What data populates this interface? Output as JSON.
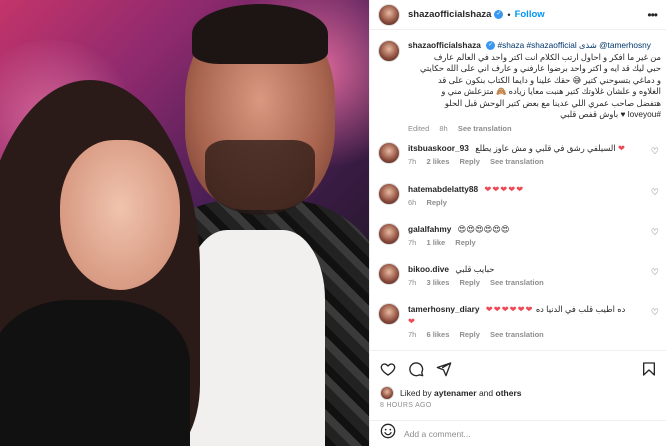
{
  "header": {
    "username": "shazaofficialshaza",
    "separator": "•",
    "follow_label": "Follow",
    "more_icon": "more-horizontal-icon"
  },
  "caption": {
    "username": "shazaofficialshaza",
    "tags_line": "#shaza #shazaofficial شذى @tamerhosny",
    "text_lines": [
      "من غير ما افكر و احاول ارتب الكلام انت اكتر واحد في العالم عارف",
      "حبي ليك قد ايه و اكتر واحد برضوا عارفني و عارف اني على الله حكايتي",
      "و دماغي بتسوحني كتير 😅 حقك علينا و دايما الكتاب بنكون على قد",
      "الغلاوه و علشان غلاوتك كتير هنبت معايا زياده 🙈 متزعلش مني و",
      "هتفضل صاحب عمري اللي عدينا مع بعض كتير الوحش قبل الحلو",
      "#loveyou ♥ باوش قفص قلبي"
    ],
    "edited": "Edited",
    "time": "8h",
    "see_translation": "See translation"
  },
  "comments": [
    {
      "username": "itsbuaskoor_93",
      "text": "السيلفي رشق في قلبي و مش عاوز يطلع",
      "hearts": "❤",
      "time": "7h",
      "likes": "2 likes",
      "reply": "Reply",
      "see_translation": "See translation"
    },
    {
      "username": "hatemabdelatty88",
      "text": "",
      "hearts": "❤❤❤❤❤",
      "time": "6h",
      "likes": "",
      "reply": "Reply",
      "see_translation": ""
    },
    {
      "username": "galalfahmy",
      "text": "",
      "hearts": "😍😍😍😍😍😍",
      "time": "7h",
      "likes": "1 like",
      "reply": "Reply",
      "see_translation": ""
    },
    {
      "username": "bikoo.dive",
      "text": "حبايب قلبي",
      "hearts": "",
      "time": "7h",
      "likes": "3 likes",
      "reply": "Reply",
      "see_translation": "See translation"
    },
    {
      "username": "tamerhosny_diary",
      "text": "ده اطيب قلب في الدنيا ده",
      "hearts": "❤❤❤❤❤❤",
      "hearts2": "❤",
      "time": "7h",
      "likes": "6 likes",
      "reply": "Reply",
      "see_translation": "See translation"
    }
  ],
  "actions": {
    "like_icon": "heart-icon",
    "comment_icon": "comment-icon",
    "share_icon": "share-icon",
    "save_icon": "bookmark-icon",
    "liked_by_prefix": "Liked by ",
    "liked_by_user": "aytenamer",
    "liked_by_suffix": " and ",
    "liked_by_others": "others",
    "time_ago": "8 HOURS AGO"
  },
  "add_comment": {
    "emoji_icon": "smiley-icon",
    "placeholder": "Add a comment..."
  }
}
